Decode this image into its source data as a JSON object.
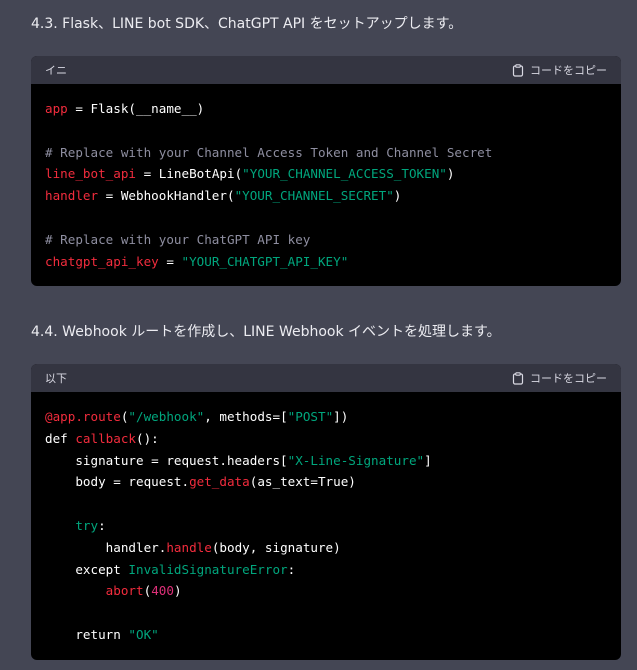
{
  "section1": {
    "heading": "4.3. Flask、LINE bot SDK、ChatGPT API をセットアップします。",
    "code_block": {
      "language": "イニ",
      "copy_label": "コードをコピー",
      "lines": [
        [
          {
            "t": "app",
            "c": "k-red"
          },
          {
            "t": " = Flask(__name__)",
            "c": "k-plain"
          }
        ],
        [],
        [
          {
            "t": "# Replace with your Channel Access Token and Channel Secret",
            "c": "k-comment"
          }
        ],
        [
          {
            "t": "line_bot_api",
            "c": "k-red"
          },
          {
            "t": " = LineBotApi(",
            "c": "k-plain"
          },
          {
            "t": "\"YOUR_CHANNEL_ACCESS_TOKEN\"",
            "c": "k-str"
          },
          {
            "t": ")",
            "c": "k-plain"
          }
        ],
        [
          {
            "t": "handler",
            "c": "k-red"
          },
          {
            "t": " = WebhookHandler(",
            "c": "k-plain"
          },
          {
            "t": "\"YOUR_CHANNEL_SECRET\"",
            "c": "k-str"
          },
          {
            "t": ")",
            "c": "k-plain"
          }
        ],
        [],
        [
          {
            "t": "# Replace with your ChatGPT API key",
            "c": "k-comment"
          }
        ],
        [
          {
            "t": "chatgpt_api_key",
            "c": "k-red"
          },
          {
            "t": " = ",
            "c": "k-plain"
          },
          {
            "t": "\"YOUR_CHATGPT_API_KEY\"",
            "c": "k-str"
          }
        ]
      ]
    }
  },
  "section2": {
    "heading": "4.4. Webhook ルートを作成し、LINE Webhook イベントを処理します。",
    "code_block": {
      "language": "以下",
      "copy_label": "コードをコピー",
      "lines": [
        [
          {
            "t": "@app.route",
            "c": "k-red"
          },
          {
            "t": "(",
            "c": "k-plain"
          },
          {
            "t": "\"/webhook\"",
            "c": "k-str"
          },
          {
            "t": ", methods=[",
            "c": "k-plain"
          },
          {
            "t": "\"POST\"",
            "c": "k-str"
          },
          {
            "t": "])",
            "c": "k-plain"
          }
        ],
        [
          {
            "t": "def ",
            "c": "k-plain"
          },
          {
            "t": "callback",
            "c": "k-red"
          },
          {
            "t": "():",
            "c": "k-plain"
          }
        ],
        [
          {
            "t": "    signature = request.headers[",
            "c": "k-plain"
          },
          {
            "t": "\"X-Line-Signature\"",
            "c": "k-str"
          },
          {
            "t": "]",
            "c": "k-plain"
          }
        ],
        [
          {
            "t": "    body = request.",
            "c": "k-plain"
          },
          {
            "t": "get_data",
            "c": "k-red"
          },
          {
            "t": "(as_text=True)",
            "c": "k-plain"
          }
        ],
        [],
        [
          {
            "t": "    ",
            "c": "k-plain"
          },
          {
            "t": "try",
            "c": "k-green"
          },
          {
            "t": ":",
            "c": "k-plain"
          }
        ],
        [
          {
            "t": "        handler.",
            "c": "k-plain"
          },
          {
            "t": "handle",
            "c": "k-red"
          },
          {
            "t": "(body, signature)",
            "c": "k-plain"
          }
        ],
        [
          {
            "t": "    except ",
            "c": "k-plain"
          },
          {
            "t": "InvalidSignatureError",
            "c": "k-green"
          },
          {
            "t": ":",
            "c": "k-plain"
          }
        ],
        [
          {
            "t": "        ",
            "c": "k-plain"
          },
          {
            "t": "abort",
            "c": "k-red"
          },
          {
            "t": "(",
            "c": "k-plain"
          },
          {
            "t": "400",
            "c": "k-num"
          },
          {
            "t": ")",
            "c": "k-plain"
          }
        ],
        [],
        [
          {
            "t": "    return ",
            "c": "k-plain"
          },
          {
            "t": "\"OK\"",
            "c": "k-str"
          }
        ]
      ]
    }
  }
}
